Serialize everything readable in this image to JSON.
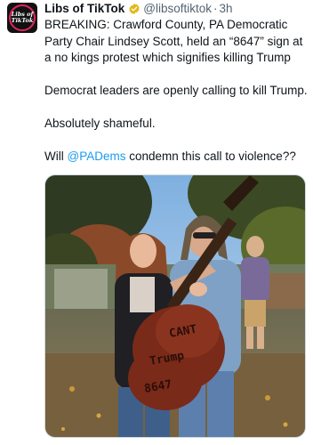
{
  "author": {
    "name": "Libs of TikTok",
    "handle": "@libsoftiktok",
    "separator": "·",
    "time": "3h",
    "avatar_text": "Libs of TikTok"
  },
  "tweet": {
    "paragraph_1": "BREAKING: Crawford County, PA Democratic Party Chair Lindsey Scott, held an “8647” sign at a no kings protest which signifies killing Trump",
    "paragraph_2": "Democrat leaders are openly calling to kill Trump.",
    "paragraph_3": "Absolutely shameful.",
    "paragraph_4_prefix": "Will ",
    "mention": "@PADems",
    "paragraph_4_suffix": " condemn this call to violence??"
  },
  "photo": {
    "guitar_text_1": "CANT",
    "guitar_text_2": "Trump",
    "guitar_text_3": "8647"
  },
  "icons": {
    "verified": "verified-badge-icon"
  },
  "colors": {
    "verified_gold": "#e2b719",
    "link_blue": "#1d9bf0"
  }
}
